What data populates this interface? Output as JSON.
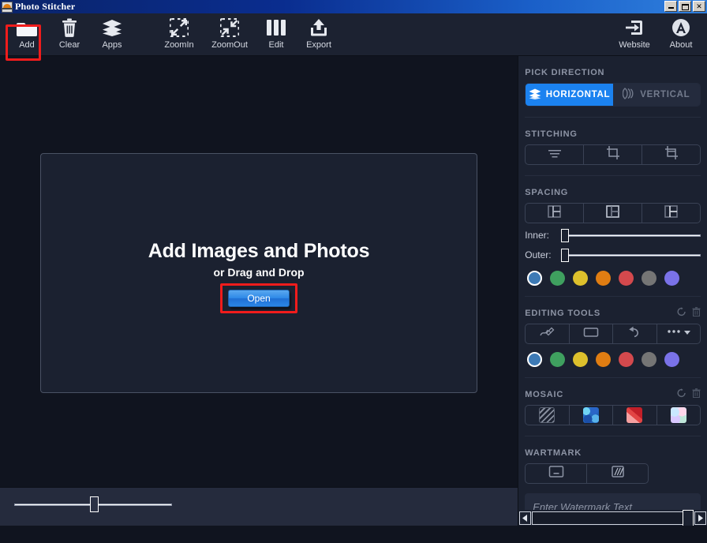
{
  "window": {
    "title": "Photo Stitcher",
    "app_icon": "photo-stitcher-icon",
    "minimize_label": "",
    "maximize_label": "",
    "close_label": "✕"
  },
  "toolbar": {
    "items": [
      {
        "label": "Add",
        "icon": "folder-icon",
        "highlighted": true
      },
      {
        "label": "Clear",
        "icon": "trash-icon",
        "highlighted": false
      },
      {
        "label": "Apps",
        "icon": "layers-icon",
        "highlighted": false
      },
      {
        "label": "ZoomIn",
        "icon": "zoom-in-icon",
        "highlighted": false
      },
      {
        "label": "ZoomOut",
        "icon": "zoom-out-icon",
        "highlighted": false
      },
      {
        "label": "Edit",
        "icon": "columns-icon",
        "highlighted": false
      },
      {
        "label": "Export",
        "icon": "export-icon",
        "highlighted": false
      }
    ],
    "right_items": [
      {
        "label": "Website",
        "icon": "arrow-into-box-icon"
      },
      {
        "label": "About",
        "icon": "about-circle-icon"
      }
    ]
  },
  "canvas": {
    "dropzone": {
      "title": "Add Images and Photos",
      "subtitle": "or Drag and Drop",
      "open_button": "Open",
      "open_button_highlighted": true
    },
    "zoom_slider": {
      "value": 48,
      "min": 0,
      "max": 100
    }
  },
  "panel": {
    "pick_direction": {
      "title": "PICK DIRECTION",
      "options": [
        {
          "label": "HORIZONTAL",
          "icon": "layers-stack-icon",
          "active": true
        },
        {
          "label": "VERTICAL",
          "icon": "vertical-waves-icon",
          "active": false
        }
      ]
    },
    "stitching": {
      "title": "STITCHING",
      "buttons": [
        {
          "icon": "align-lines-icon",
          "name": "stitch-align"
        },
        {
          "icon": "crop-icon",
          "name": "stitch-crop"
        },
        {
          "icon": "crop-wide-icon",
          "name": "stitch-crop-wide"
        }
      ]
    },
    "spacing": {
      "title": "SPACING",
      "buttons": [
        {
          "icon": "layout-panel-left-icon",
          "name": "spacing-layout-1"
        },
        {
          "icon": "layout-panel-split-icon",
          "name": "spacing-layout-2"
        },
        {
          "icon": "layout-panel-right-icon",
          "name": "spacing-layout-3"
        }
      ],
      "inner_label": "Inner:",
      "outer_label": "Outer:",
      "inner_value": 0,
      "outer_value": 0,
      "colors": [
        {
          "hex": "#3d7ab5",
          "selected": true
        },
        {
          "hex": "#3fa05f",
          "selected": false
        },
        {
          "hex": "#ddc02c",
          "selected": false
        },
        {
          "hex": "#e07d12",
          "selected": false
        },
        {
          "hex": "#d4494d",
          "selected": false
        },
        {
          "hex": "#757575",
          "selected": false
        },
        {
          "hex": "#7a72e8",
          "selected": false
        }
      ]
    },
    "editing_tools": {
      "title": "EDITING TOOLS",
      "reset_icon": "reset-circle-icon",
      "delete_icon": "trash-icon",
      "buttons": [
        {
          "icon": "brush-icon",
          "name": "tool-brush"
        },
        {
          "icon": "rectangle-icon",
          "name": "tool-rectangle"
        },
        {
          "icon": "undo-icon",
          "name": "tool-undo"
        },
        {
          "icon": "more-dropdown-icon",
          "name": "tool-more"
        }
      ],
      "colors": [
        {
          "hex": "#3d7ab5",
          "selected": true
        },
        {
          "hex": "#3fa05f",
          "selected": false
        },
        {
          "hex": "#ddc02c",
          "selected": false
        },
        {
          "hex": "#e07d12",
          "selected": false
        },
        {
          "hex": "#d4494d",
          "selected": false
        },
        {
          "hex": "#757575",
          "selected": false
        },
        {
          "hex": "#7a72e8",
          "selected": false
        }
      ]
    },
    "mosaic": {
      "title": "MOSAIC",
      "reset_icon": "reset-circle-icon",
      "delete_icon": "trash-icon",
      "buttons": [
        {
          "icon": "hatch-pattern-icon",
          "name": "mosaic-none"
        },
        {
          "icon": "mosaic-blue-icon",
          "name": "mosaic-blue"
        },
        {
          "icon": "mosaic-red-icon",
          "name": "mosaic-red"
        },
        {
          "icon": "mosaic-pastel-icon",
          "name": "mosaic-pastel"
        }
      ]
    },
    "watermark": {
      "title": "WARTMARK",
      "buttons": [
        {
          "icon": "watermark-box-icon",
          "name": "watermark-text-mode"
        },
        {
          "icon": "watermark-tile-icon",
          "name": "watermark-tile-mode"
        }
      ],
      "input_value": "",
      "input_placeholder": "Enter Watermark Text",
      "colors": [
        {
          "hex": "#3d7ab5",
          "selected": true
        },
        {
          "hex": "#3fa05f",
          "selected": false
        },
        {
          "hex": "#ddc02c",
          "selected": false
        },
        {
          "hex": "#e07d12",
          "selected": false
        },
        {
          "hex": "#d4494d",
          "selected": false
        },
        {
          "hex": "#757575",
          "selected": false
        },
        {
          "hex": "#7a72e8",
          "selected": false
        }
      ]
    },
    "scrollbar": {
      "left_arrow": "◀",
      "right_arrow": "▶"
    }
  },
  "theme": {
    "accent": "#1b82f0",
    "highlight": "#f01c1c",
    "panel_bg": "#1b2130",
    "canvas_bg": "#10141f"
  }
}
